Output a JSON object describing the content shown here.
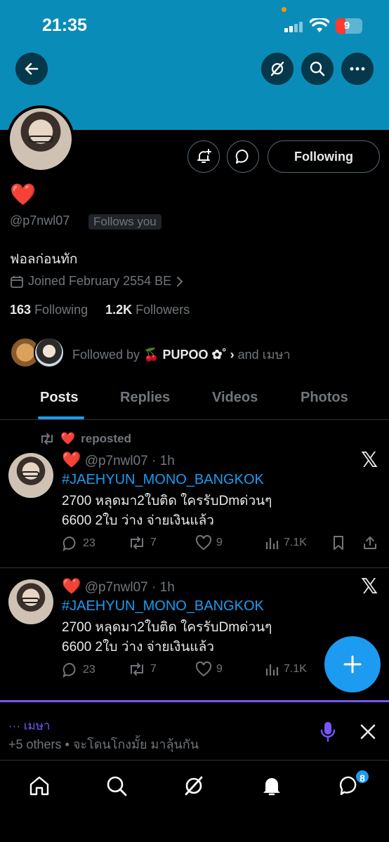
{
  "status_bar": {
    "time": "21:35",
    "battery": "9"
  },
  "profile": {
    "name": "❤️",
    "handle": "@p7nwl07",
    "follows_you": "Follows you",
    "bio": "ฟอลก่อนทัก",
    "joined": "Joined February 2554 BE",
    "following_count": "163",
    "following_label": "Following",
    "followers_count": "1.2K",
    "followers_label": "Followers",
    "followed_by_prefix": "Followed by",
    "followed_by_names": "🍒 PUPOO ✿˚ ›",
    "followed_by_and": "and",
    "followed_by_second": "เมษา",
    "following_button": "Following"
  },
  "tabs": [
    "Posts",
    "Replies",
    "Videos",
    "Photos"
  ],
  "posts": [
    {
      "repost_name": "❤️",
      "repost_label": "reposted",
      "author": "❤️",
      "handle": "@p7nwl07",
      "time": "· 1h",
      "hashtag": "#JAEHYUN_MONO_BANGKOK",
      "text": "2700 หลุดมา2ใบติด ใครรับDmด่วนๆ\n6600 2ใบ ว่าง จ่ายเงินแล้ว",
      "replies": "23",
      "reposts": "7",
      "likes": "9",
      "views": "7.1K"
    },
    {
      "author": "❤️",
      "handle": "@p7nwl07",
      "time": "· 1h",
      "hashtag": "#JAEHYUN_MONO_BANGKOK",
      "text": "2700 หลุดมา2ใบติด ใครรับDmด่วนๆ\n6600 2ใบ ว่าง จ่ายเงินแล้ว",
      "replies": "23",
      "reposts": "7",
      "likes": "9",
      "views": "7.1K"
    }
  ],
  "dm_preview": {
    "name": "··· เมษา",
    "message": "+5 others • จะโดนโกงมั้ย มาลุ้นกัน"
  },
  "nav_badge": "8",
  "colors": {
    "accent": "#1d9bf0",
    "banner": "#0a8cb8",
    "dm_accent": "#7856ff",
    "heart": "#f4212e"
  }
}
